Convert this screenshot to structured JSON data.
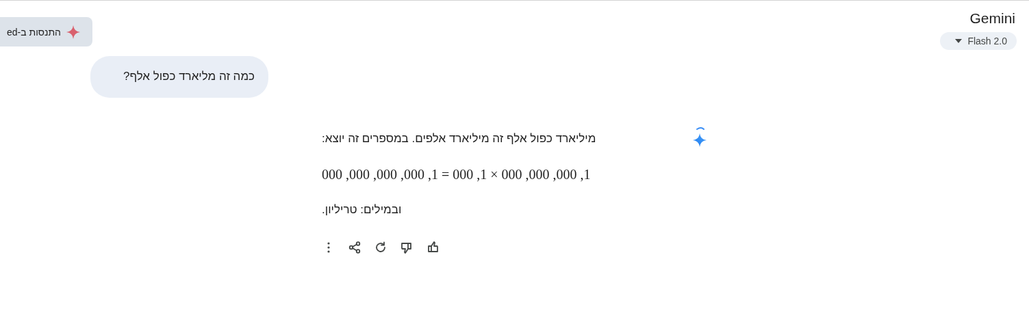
{
  "header": {
    "experiment_button": "התנסות ב-ed",
    "title": "Gemini",
    "model_selector": "Flash 2.0"
  },
  "user_message": "כמה זה מליארד כפול אלף?",
  "response": {
    "blocks": [
      {
        "kind": "text",
        "text": "מיליארד כפול אלף זה מיליארד אלפים. במספרים זה יוצא:"
      },
      {
        "kind": "math",
        "text": "000 ,000 ,000 ,000 ,1 = 000 ,1 × 000 ,000 ,000 ,1"
      },
      {
        "kind": "text",
        "text": "ובמילים: טריליון."
      }
    ],
    "actions": [
      {
        "kind": "more"
      },
      {
        "kind": "share"
      },
      {
        "kind": "regenerate"
      },
      {
        "kind": "thumbs_down"
      },
      {
        "kind": "thumbs_up"
      }
    ]
  }
}
